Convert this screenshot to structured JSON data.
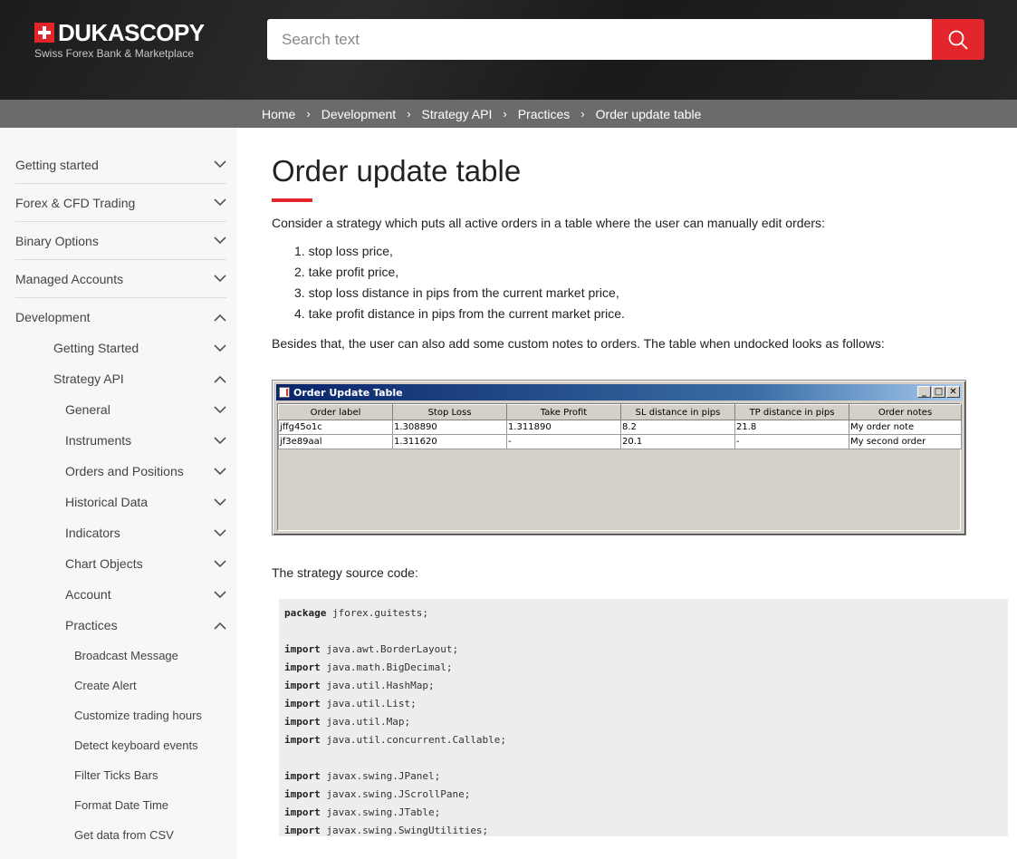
{
  "header": {
    "logo_word": "DUKASCOPY",
    "logo_tagline": "Swiss Forex Bank & Marketplace",
    "search_placeholder": "Search text",
    "brand_color": "#e3262c"
  },
  "breadcrumb": [
    "Home",
    "Development",
    "Strategy API",
    "Practices",
    "Order update table"
  ],
  "sidebar": {
    "top_items": [
      {
        "label": "Getting started",
        "expanded": false
      },
      {
        "label": "Forex & CFD Trading",
        "expanded": false
      },
      {
        "label": "Binary Options",
        "expanded": false
      },
      {
        "label": "Managed Accounts",
        "expanded": false
      },
      {
        "label": "Development",
        "expanded": true
      }
    ],
    "development_children": [
      {
        "label": "Getting Started",
        "expanded": false
      },
      {
        "label": "Strategy API",
        "expanded": true
      }
    ],
    "strategy_api_children": [
      {
        "label": "General",
        "expanded": false
      },
      {
        "label": "Instruments",
        "expanded": false
      },
      {
        "label": "Orders and Positions",
        "expanded": false
      },
      {
        "label": "Historical Data",
        "expanded": false
      },
      {
        "label": "Indicators",
        "expanded": false
      },
      {
        "label": "Chart Objects",
        "expanded": false
      },
      {
        "label": "Account",
        "expanded": false
      },
      {
        "label": "Practices",
        "expanded": true
      }
    ],
    "practices_children": [
      "Broadcast Message",
      "Create Alert",
      "Customize trading hours",
      "Detect keyboard events",
      "Filter Ticks Bars",
      "Format Date Time",
      "Get data from CSV"
    ]
  },
  "content": {
    "title": "Order update table",
    "intro": "Consider a strategy which puts all active orders in a table where the user can manually edit orders:",
    "list": [
      "stop loss price,",
      "take profit price,",
      "stop loss distance in pips from the current market price,",
      "take profit distance in pips from the current market price."
    ],
    "besides": "Besides that, the user can also add some custom notes to orders. The table when undocked looks as follows:",
    "source_label": "The strategy source code:"
  },
  "swing_window": {
    "title": "Order Update Table",
    "columns": [
      "Order label",
      "Stop Loss",
      "Take Profit",
      "SL distance in pips",
      "TP distance in pips",
      "Order notes"
    ],
    "rows": [
      [
        "jffg45o1c",
        "1.308890",
        "1.311890",
        "8.2",
        "21.8",
        "My order note"
      ],
      [
        "jf3e89aal",
        "1.311620",
        "-",
        "20.1",
        "-",
        "My second order"
      ]
    ]
  },
  "code_lines": [
    {
      "kw": "package",
      "rest": " jforex.guitests;"
    },
    {
      "kw": "",
      "rest": ""
    },
    {
      "kw": "import",
      "rest": " java.awt.BorderLayout;"
    },
    {
      "kw": "import",
      "rest": " java.math.BigDecimal;"
    },
    {
      "kw": "import",
      "rest": " java.util.HashMap;"
    },
    {
      "kw": "import",
      "rest": " java.util.List;"
    },
    {
      "kw": "import",
      "rest": " java.util.Map;"
    },
    {
      "kw": "import",
      "rest": " java.util.concurrent.Callable;"
    },
    {
      "kw": "",
      "rest": ""
    },
    {
      "kw": "import",
      "rest": " javax.swing.JPanel;"
    },
    {
      "kw": "import",
      "rest": " javax.swing.JScrollPane;"
    },
    {
      "kw": "import",
      "rest": " javax.swing.JTable;"
    },
    {
      "kw": "import",
      "rest": " javax.swing.SwingUtilities;"
    }
  ]
}
